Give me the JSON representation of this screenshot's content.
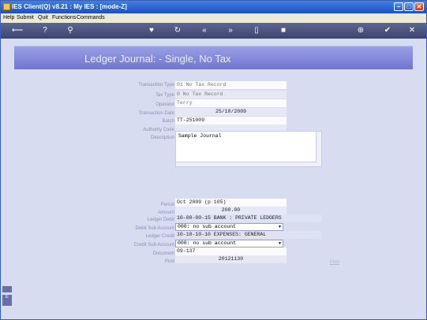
{
  "window": {
    "title": "IES Client(Q) v8.21 : My IES :      [mode-Z]"
  },
  "menu": [
    "Help",
    "Submit",
    "Quit",
    "Functions",
    "Commands"
  ],
  "toolbar_icons": [
    "back-key-icon",
    "help-icon",
    "search-icon",
    "heart-icon",
    "refresh-icon",
    "rewind-icon",
    "fast-forward-icon",
    "save-icon",
    "delete-icon",
    "add-icon",
    "ok-icon",
    "close-icon"
  ],
  "header": {
    "title": "Ledger Journal: -    Single, No Tax"
  },
  "form": {
    "transaction_type": {
      "label": "Transaction Type",
      "value": "01 No Tax Record"
    },
    "tax_type": {
      "label": "Tax Type",
      "value": "0 No Tax Record"
    },
    "operator": {
      "label": "Operator",
      "value": "Terry"
    },
    "transaction_date": {
      "label": "Transaction Date",
      "value": "25/10/2009"
    },
    "batch": {
      "label": "Batch",
      "value": "TT-251009"
    },
    "authority_code": {
      "label": "Authority Code",
      "value": ""
    },
    "description": {
      "label": "Description",
      "value": "Sample Journal"
    },
    "period": {
      "label": "Period",
      "value": "Oct 2009 (p 105)"
    },
    "amount": {
      "label": "Amount",
      "value": "200.00"
    },
    "ledger_debit": {
      "label": "Ledger Debit",
      "value": "10-00-00-15 BANK : PRIVATE LEDGERS"
    },
    "debit_sub_account": {
      "label": "Debit Sub Account",
      "value": "000: no sub account"
    },
    "ledger_credit": {
      "label": "Ledger Credit",
      "value": "10-10-10-10 EXPENSES: GENERAL"
    },
    "credit_sub_account": {
      "label": "Credit Sub Account",
      "value": "000: no sub account"
    },
    "document": {
      "label": "Document",
      "value": "09-137"
    },
    "post": {
      "label": "Post",
      "value": "20121130"
    },
    "link_text": "Post"
  }
}
